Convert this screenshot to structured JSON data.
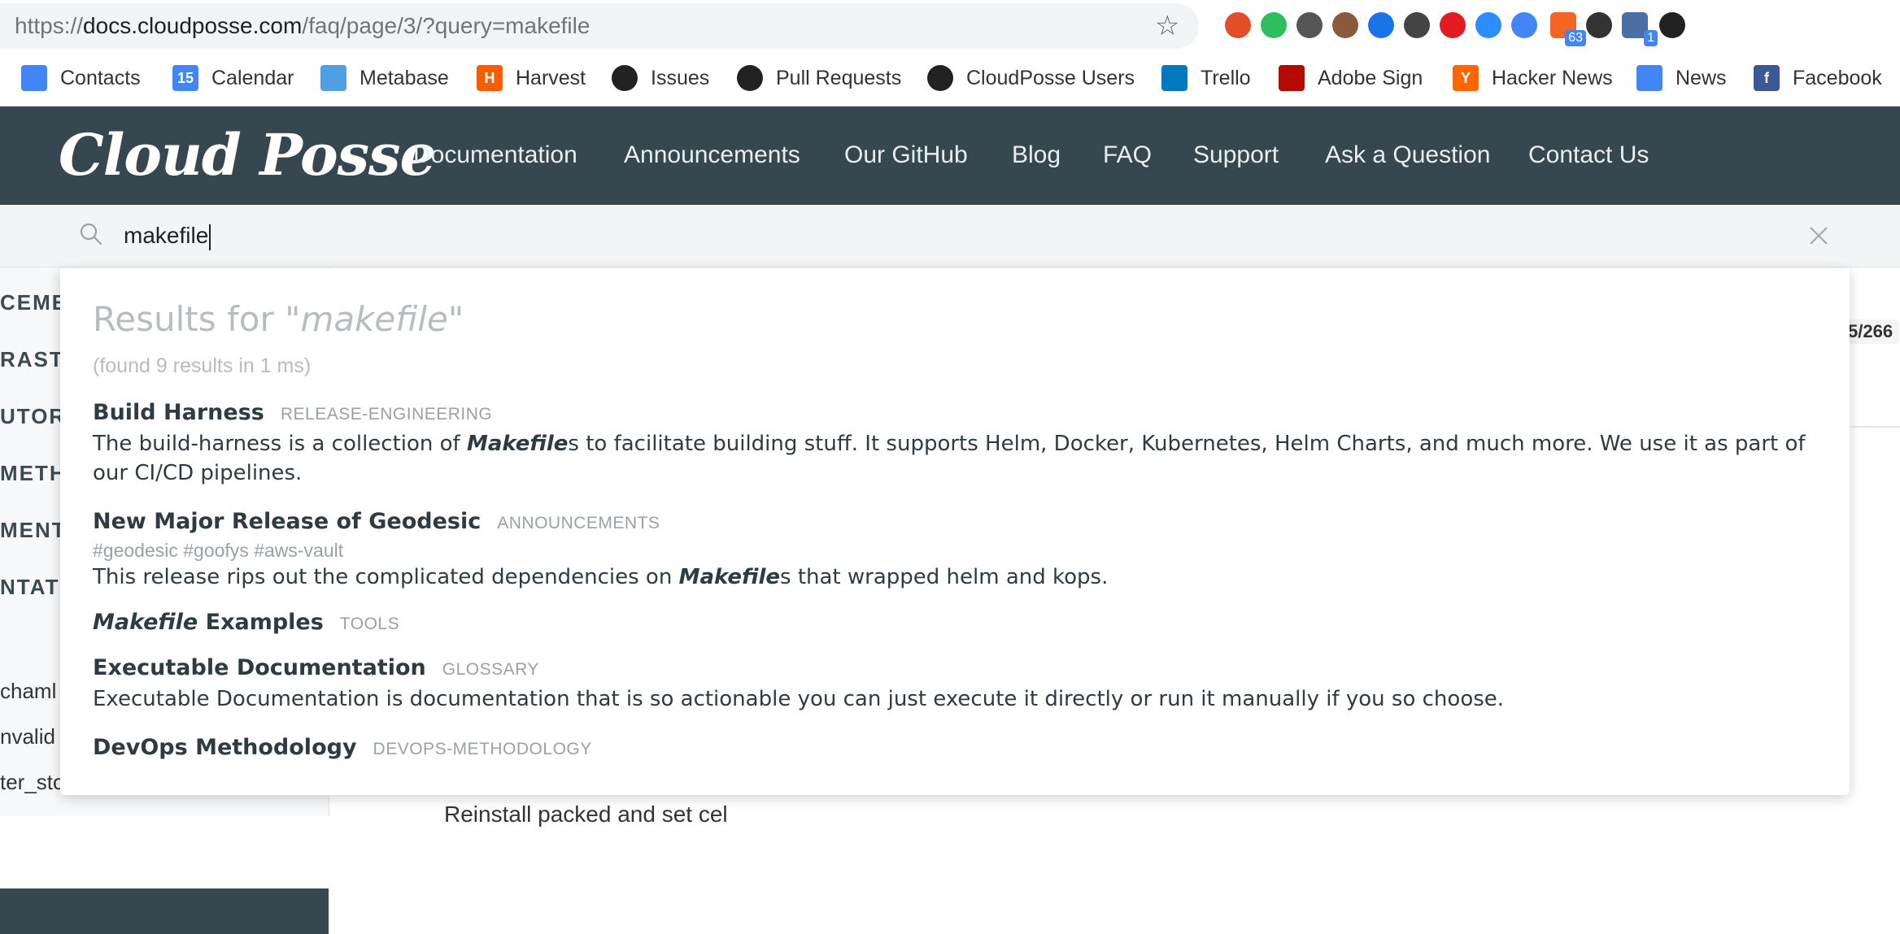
{
  "browser": {
    "url_scheme": "https://",
    "url_host": "docs.cloudposse.com",
    "url_path": "/faq/page/3/?query=makefile",
    "extensions": [
      {
        "name": "color-wheel-icon",
        "color": "#e44d26"
      },
      {
        "name": "evernote-icon",
        "color": "#2dbe60"
      },
      {
        "name": "pocket-icon",
        "color": "#555555"
      },
      {
        "name": "cookie-icon",
        "color": "#8b5a3c"
      },
      {
        "name": "circle-ring-icon",
        "color": "#1a73e8"
      },
      {
        "name": "hexagon-icon",
        "color": "#444444"
      },
      {
        "name": "adobe-acrobat-icon",
        "color": "#e31b23"
      },
      {
        "name": "zoom-camera-icon",
        "color": "#2d8cff"
      },
      {
        "name": "google-docs-tag-icon",
        "color": "#4285f4"
      },
      {
        "name": "rss-feed-icon",
        "color": "#f26522",
        "badge": "63"
      },
      {
        "name": "onepassword-icon",
        "color": "#333333"
      },
      {
        "name": "code-tag-icon",
        "color": "#4a6fa5",
        "badge": "1"
      },
      {
        "name": "layers-icon",
        "color": "#222222"
      }
    ]
  },
  "bookmarks": [
    {
      "label": "Contacts",
      "icon": "contacts-icon",
      "color": "#4285f4"
    },
    {
      "label": "Calendar",
      "icon": "calendar-icon",
      "color": "#4285f4",
      "glyph": "15"
    },
    {
      "label": "Metabase",
      "icon": "metabase-icon",
      "color": "#509ee3"
    },
    {
      "label": "Harvest",
      "icon": "harvest-icon",
      "color": "#fa5d00",
      "glyph": "H"
    },
    {
      "label": "Issues",
      "icon": "github-icon",
      "color": "#222222"
    },
    {
      "label": "Pull Requests",
      "icon": "github-icon",
      "color": "#222222"
    },
    {
      "label": "CloudPosse Users",
      "icon": "github-icon",
      "color": "#222222"
    },
    {
      "label": "Trello",
      "icon": "trello-icon",
      "color": "#0079bf"
    },
    {
      "label": "Adobe Sign",
      "icon": "adobe-sign-icon",
      "color": "#b30b00"
    },
    {
      "label": "Hacker News",
      "icon": "hacker-news-icon",
      "color": "#ff6600",
      "glyph": "Y"
    },
    {
      "label": "News",
      "icon": "google-news-icon",
      "color": "#4285f4"
    },
    {
      "label": "Facebook",
      "icon": "facebook-icon",
      "color": "#3b5998",
      "glyph": "f"
    }
  ],
  "site": {
    "logo": "Cloud Posse",
    "nav": [
      "Documentation",
      "Announcements",
      "Our GitHub",
      "Blog",
      "FAQ",
      "Support",
      "Ask a Question",
      "Contact Us"
    ],
    "header_color": "#37474f"
  },
  "search": {
    "query": "makefile"
  },
  "background_page": {
    "sidebar_fragments": [
      "CEME",
      "RASTR",
      "UTOR",
      "METHO",
      "MENT",
      "NTATI"
    ],
    "sidebar_items": [
      "chaml",
      "nvalid",
      "ter_sto"
    ],
    "page_counter": "5/266",
    "bottom_text": "Reinstall packed and set cel"
  },
  "results": {
    "heading_prefix": "Results for \"",
    "heading_term": "makefile",
    "heading_suffix": "\"",
    "meta": "(found 9 results in 1 ms)",
    "items": [
      {
        "title": "Build Harness",
        "category": "RELEASE-ENGINEERING",
        "desc_before": "The build-harness is a collection of ",
        "desc_match": "Makefile",
        "desc_after": "s to facilitate building stuff. It supports Helm, Docker, Kubernetes, Helm Charts, and much more. We use it as part of our CI/CD pipelines."
      },
      {
        "title": "New Major Release of Geodesic",
        "category": "ANNOUNCEMENTS",
        "tags": "#geodesic #goofys #aws-vault",
        "desc_before": "This release rips out the complicated dependencies on ",
        "desc_match": "Makefile",
        "desc_after": "s that wrapped helm and kops."
      },
      {
        "title_match": "Makefile",
        "title_rest": " Examples",
        "category": "TOOLS"
      },
      {
        "title": "Executable Documentation",
        "category": "GLOSSARY",
        "desc": "Executable Documentation is documentation that is so actionable you can just execute it directly or run it manually if you so choose."
      },
      {
        "title": "DevOps Methodology",
        "category": "DEVOPS-METHODOLOGY"
      }
    ]
  }
}
